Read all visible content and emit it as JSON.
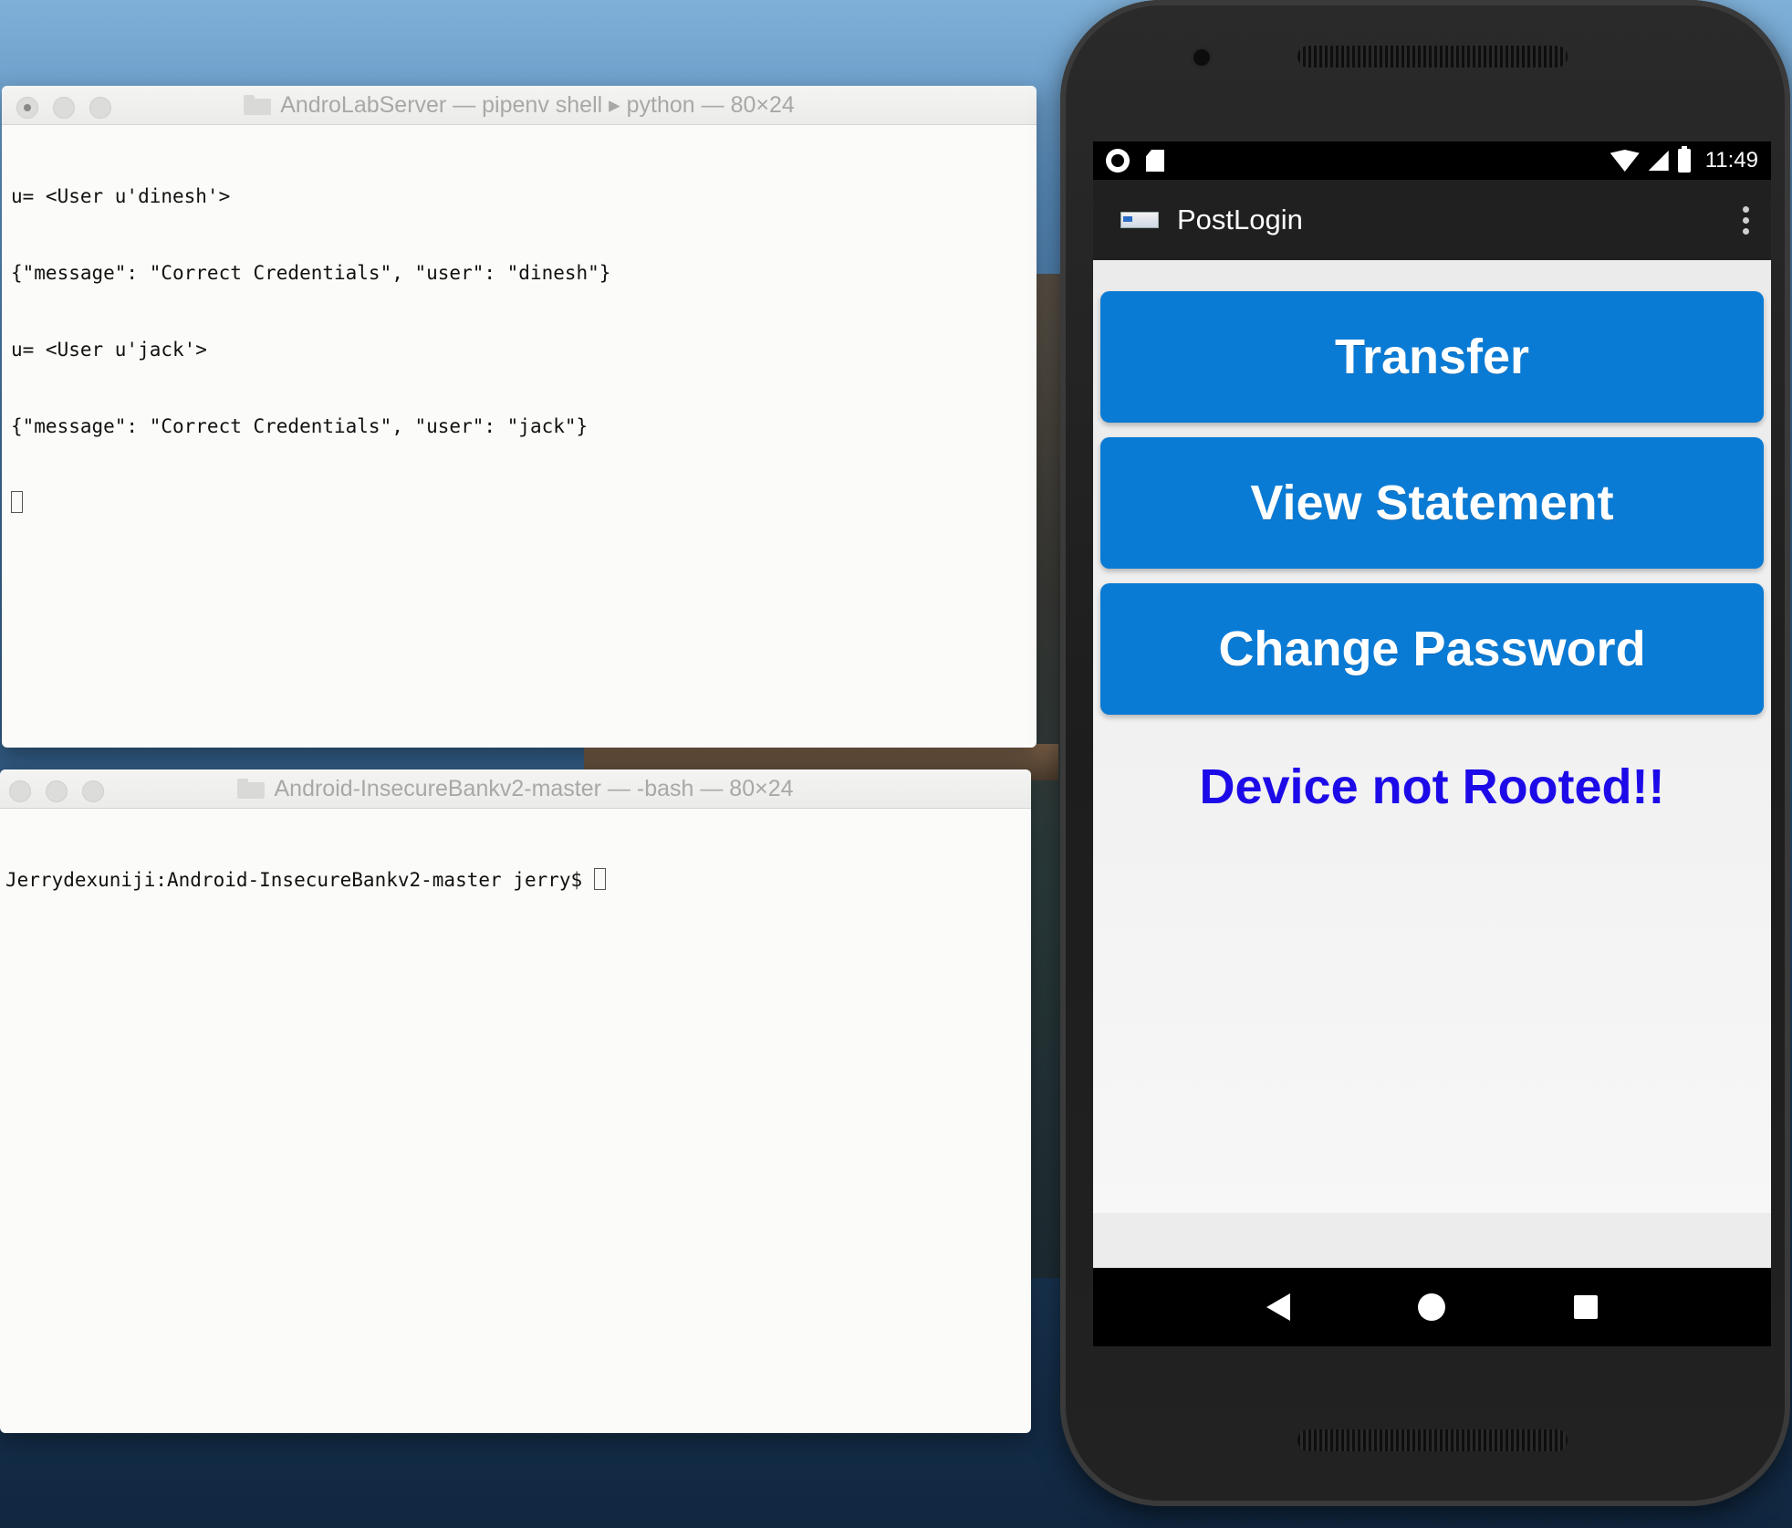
{
  "terminal_top": {
    "title": "AndroLabServer — pipenv shell ▸ python — 80×24",
    "lines": [
      "u= <User u'dinesh'>",
      "{\"message\": \"Correct Credentials\", \"user\": \"dinesh\"}",
      "u= <User u'jack'>",
      "{\"message\": \"Correct Credentials\", \"user\": \"jack\"}"
    ]
  },
  "terminal_bottom": {
    "title": "Android-InsecureBankv2-master — -bash — 80×24",
    "prompt": "Jerrydexuniji:Android-InsecureBankv2-master jerry$ "
  },
  "phone": {
    "status_time": "11:49",
    "app_title": "PostLogin",
    "buttons": {
      "transfer": "Transfer",
      "view_statement": "View Statement",
      "change_password": "Change Password"
    },
    "root_status": "Device not Rooted!!"
  },
  "colors": {
    "button_blue": "#0a7bd5",
    "root_status_text": "#1d0ae8",
    "app_bar": "#202020"
  },
  "icons": {
    "status_left": [
      "screen-record-icon",
      "sd-card-icon"
    ],
    "status_right": [
      "wifi-icon",
      "cell-signal-icon",
      "battery-icon"
    ],
    "nav": [
      "back-icon",
      "home-icon",
      "recents-icon"
    ]
  }
}
